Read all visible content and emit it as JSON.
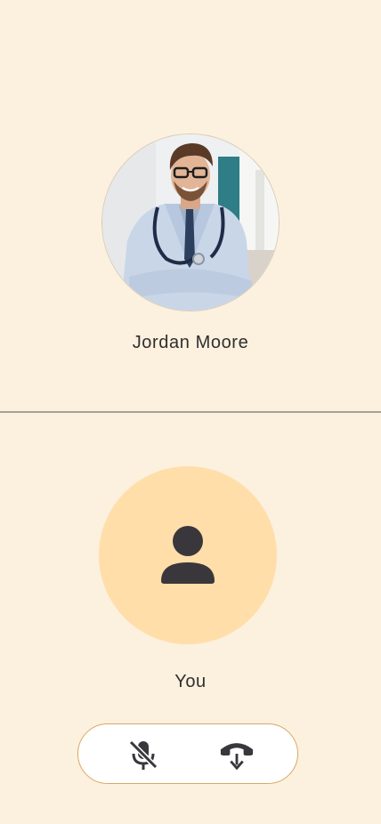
{
  "remote": {
    "name": "Jordan Moore",
    "avatar_icon": "doctor-photo"
  },
  "local": {
    "name": "You",
    "avatar_icon": "person-icon",
    "avatar_color": "#FFDEAA"
  },
  "controls": {
    "mute_icon": "mic-off-icon",
    "hangup_icon": "call-end-icon",
    "border_color": "#d9a865"
  },
  "colors": {
    "background": "#FCF0DE",
    "icon": "#3a373c"
  }
}
